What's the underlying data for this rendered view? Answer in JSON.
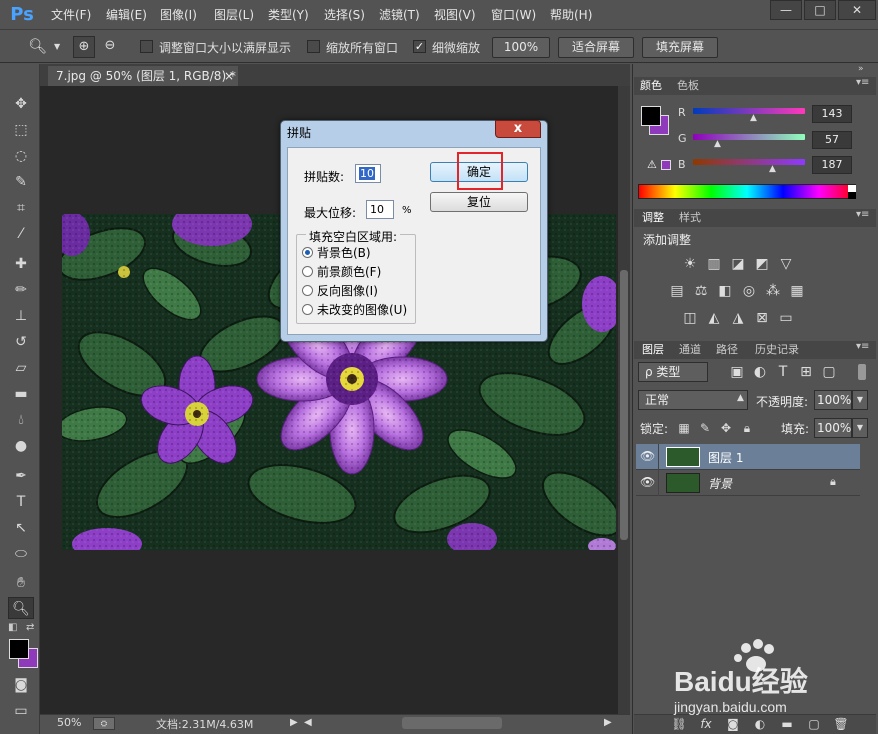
{
  "app": {
    "logo": "Ps"
  },
  "menu": [
    "文件(F)",
    "编辑(E)",
    "图像(I)",
    "图层(L)",
    "类型(Y)",
    "选择(S)",
    "滤镜(T)",
    "视图(V)",
    "窗口(W)",
    "帮助(H)"
  ],
  "window_controls": {
    "minimize": "—",
    "restore": "□",
    "close": "✕"
  },
  "options": {
    "resize_windows_label": "调整窗口大小以满屏显示",
    "resize_windows_checked": false,
    "zoom_all_label": "缩放所有窗口",
    "zoom_all_checked": false,
    "scrubby_label": "细微缩放",
    "scrubby_checked": true,
    "btn_100": "100%",
    "btn_fit": "适合屏幕",
    "btn_fill": "填充屏幕"
  },
  "document": {
    "tab_title": "7.jpg @ 50% (图层 1, RGB/8) *",
    "tab_close": "×"
  },
  "status": {
    "zoom": "50%",
    "doc_info": "文档:2.31M/4.63M"
  },
  "color_panel": {
    "tabs": [
      "颜色",
      "色板"
    ],
    "r_label": "R",
    "r_value": "143",
    "g_label": "G",
    "g_value": "57",
    "b_label": "B",
    "b_value": "187",
    "fg_color": "#000000",
    "bg_color": "#8f39bb"
  },
  "adjust_panel": {
    "tabs": [
      "调整",
      "样式"
    ],
    "title": "添加调整"
  },
  "layers_panel": {
    "tabs": [
      "图层",
      "通道",
      "路径",
      "历史记录"
    ],
    "filter_type": "ρ 类型",
    "blend_mode": "正常",
    "opacity_label": "不透明度:",
    "opacity_value": "100%",
    "lock_label": "锁定:",
    "fill_label": "填充:",
    "fill_value": "100%",
    "layers": [
      {
        "name": "图层 1",
        "selected": true
      },
      {
        "name": "背景",
        "selected": false,
        "locked": true
      }
    ]
  },
  "dialog": {
    "title": "拼贴",
    "close": "x",
    "tiles_label": "拼贴数:",
    "tiles_value": "10",
    "offset_label": "最大位移:",
    "offset_value": "10",
    "offset_unit": "%",
    "fill_group_label": "填充空白区域用:",
    "options": [
      "背景色(B)",
      "前景颜色(F)",
      "反向图像(I)",
      "未改变的图像(U)"
    ],
    "selected_option": 0,
    "ok_label": "确定",
    "reset_label": "复位"
  },
  "watermark": {
    "brand": "Baidu经验",
    "url": "jingyan.baidu.com"
  }
}
